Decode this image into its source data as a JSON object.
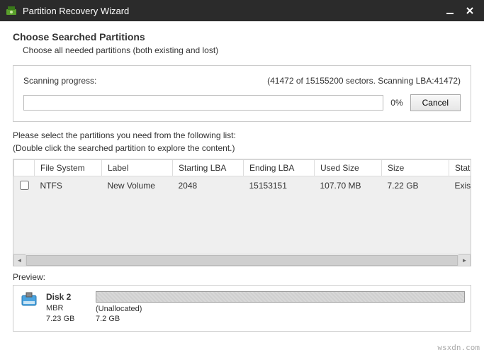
{
  "titlebar": {
    "title": "Partition Recovery Wizard"
  },
  "header": {
    "heading": "Choose Searched Partitions",
    "subheading": "Choose all needed partitions (both existing and lost)"
  },
  "scan": {
    "label": "Scanning progress:",
    "status": "(41472 of 15155200 sectors. Scanning LBA:41472)",
    "percent": "0%",
    "cancel": "Cancel"
  },
  "instructions": {
    "line1": "Please select the partitions you need from the following list:",
    "line2": "(Double click the searched partition to explore the content.)"
  },
  "table": {
    "headers": {
      "fs": "File System",
      "label": "Label",
      "start": "Starting LBA",
      "end": "Ending LBA",
      "used": "Used Size",
      "size": "Size",
      "status": "Status"
    },
    "row": {
      "fs": "NTFS",
      "label": "New Volume",
      "start": "2048",
      "end": "15153151",
      "used": "107.70 MB",
      "size": "7.22 GB",
      "status": "Existing"
    }
  },
  "preview": {
    "label": "Preview:",
    "disk_name": "Disk 2",
    "disk_type": "MBR",
    "disk_size": "7.23 GB",
    "bar_label1": "(Unallocated)",
    "bar_label2": "7.2 GB"
  },
  "watermark": "wsxdn.com"
}
